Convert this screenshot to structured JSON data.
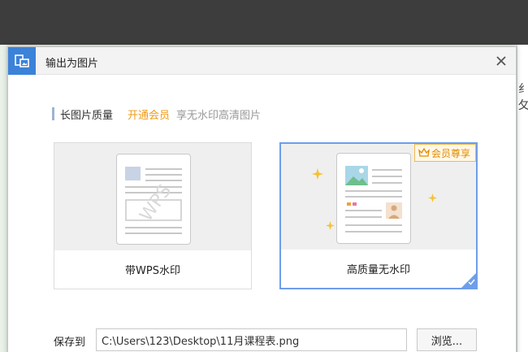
{
  "dialog": {
    "title": "输出为图片",
    "icon": "export-image-icon"
  },
  "quality": {
    "section_title": "长图片质量",
    "vip_link": "开通会员",
    "vip_desc": "享无水印高清图片"
  },
  "options": [
    {
      "label": "带WPS水印",
      "watermark_text": "WPS",
      "selected": false
    },
    {
      "label": "高质量无水印",
      "badge": "会员尊享",
      "selected": true
    }
  ],
  "save": {
    "label": "保存到",
    "path": "C:\\Users\\123\\Desktop\\11月课程表.png",
    "browse_label": "浏览..."
  },
  "colors": {
    "accent": "#3b82d9",
    "vip": "#f09a16",
    "selected_border": "#6d9eeb",
    "star": "#f5c230"
  }
}
